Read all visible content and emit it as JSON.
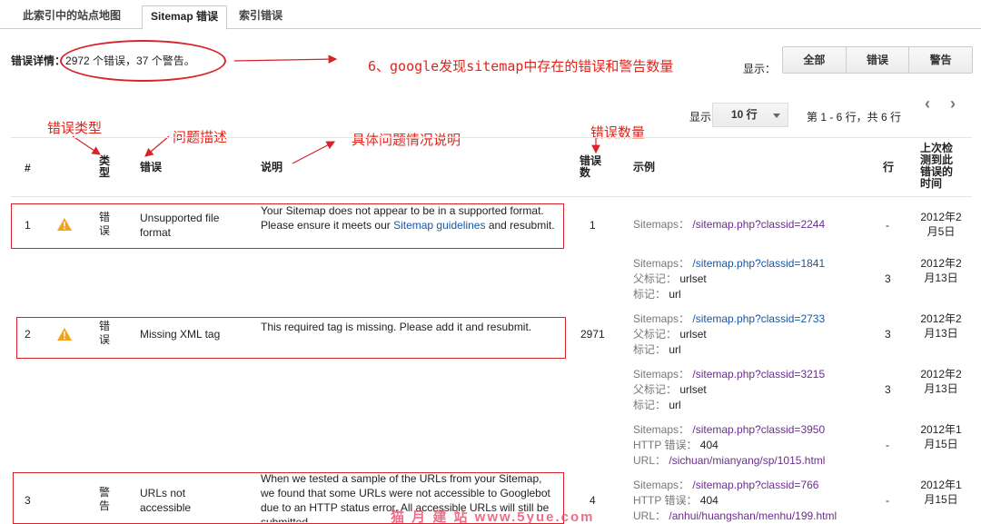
{
  "tabs": [
    {
      "label": "此索引中的站点地图"
    },
    {
      "label": "Sitemap 错误"
    },
    {
      "label": "索引错误"
    }
  ],
  "summary": {
    "label": "错误详情：",
    "text": "2972 个错误，37 个警告。"
  },
  "annotations": {
    "counts": "6、google发现sitemap中存在的错误和警告数量",
    "type": "错误类型",
    "issue": "问题描述",
    "detail": "具体问题情况说明",
    "count": "错误数量"
  },
  "filter": {
    "label": "显示：",
    "buttons": [
      "全部",
      "错误",
      "警告"
    ]
  },
  "pager": {
    "show_label": "显示",
    "rows": "10 行",
    "range": "第 1 - 6 行，共 6 行"
  },
  "columns": {
    "num": "#",
    "type": "类型",
    "error": "错误",
    "desc": "说明",
    "count": "错误数",
    "example": "示例",
    "line": "行",
    "last": "上次检测到此错误的时间"
  },
  "rows": [
    {
      "num": "1",
      "type": "错误",
      "error": "Unsupported file format",
      "desc_a": "Your Sitemap does not appear to be in a supported format. Please ensure it meets our ",
      "desc_link": "Sitemap guidelines",
      "desc_b": " and resubmit.",
      "count": "1"
    },
    {
      "num": "2",
      "type": "错误",
      "error": "Missing XML tag",
      "desc_a": "This required tag is missing. Please add it and resubmit.",
      "count": "2971"
    },
    {
      "num": "3",
      "type": "警告",
      "error": "URLs not accessible",
      "desc_a": "When we tested a sample of the URLs from your Sitemap, we found that some URLs were not accessible to Googlebot due to an HTTP status error. All accessible URLs will still be submitted.",
      "count": "4"
    }
  ],
  "samples": [
    {
      "l1": "Sitemaps：",
      "v1": "/sitemap.php?classid=2244",
      "line": "-",
      "date": "2012年2月5日"
    },
    {
      "l1": "Sitemaps：",
      "v1": "/sitemap.php?classid=1841",
      "l2": "父标记：",
      "v2": "urlset",
      "l3": "标记：",
      "v3": "url",
      "line": "3",
      "date": "2012年2月13日"
    },
    {
      "l1": "Sitemaps：",
      "v1": "/sitemap.php?classid=2733",
      "l2": "父标记：",
      "v2": "urlset",
      "l3": "标记：",
      "v3": "url",
      "line": "3",
      "date": "2012年2月13日"
    },
    {
      "l1": "Sitemaps：",
      "v1": "/sitemap.php?classid=3215",
      "l2": "父标记：",
      "v2": "urlset",
      "l3": "标记：",
      "v3": "url",
      "line": "3",
      "date": "2012年2月13日"
    },
    {
      "l1": "Sitemaps：",
      "v1": "/sitemap.php?classid=3950",
      "l2": "HTTP 错误：",
      "v2": "404",
      "l3": "URL：",
      "v3": "/sichuan/mianyang/sp/1015.html",
      "line": "-",
      "date": "2012年1月15日"
    },
    {
      "l1": "Sitemaps：",
      "v1": "/sitemap.php?classid=766",
      "l2": "HTTP 错误：",
      "v2": "404",
      "l3": "URL：",
      "v3": "/anhui/huangshan/menhu/199.html",
      "line": "-",
      "date": "2012年1月15日"
    }
  ],
  "watermark": "猫 月 建 站 www.5yue.com",
  "colors": {
    "annotation": "#e0241a",
    "link": "#1a56a6",
    "visited": "#6b2d8f"
  }
}
